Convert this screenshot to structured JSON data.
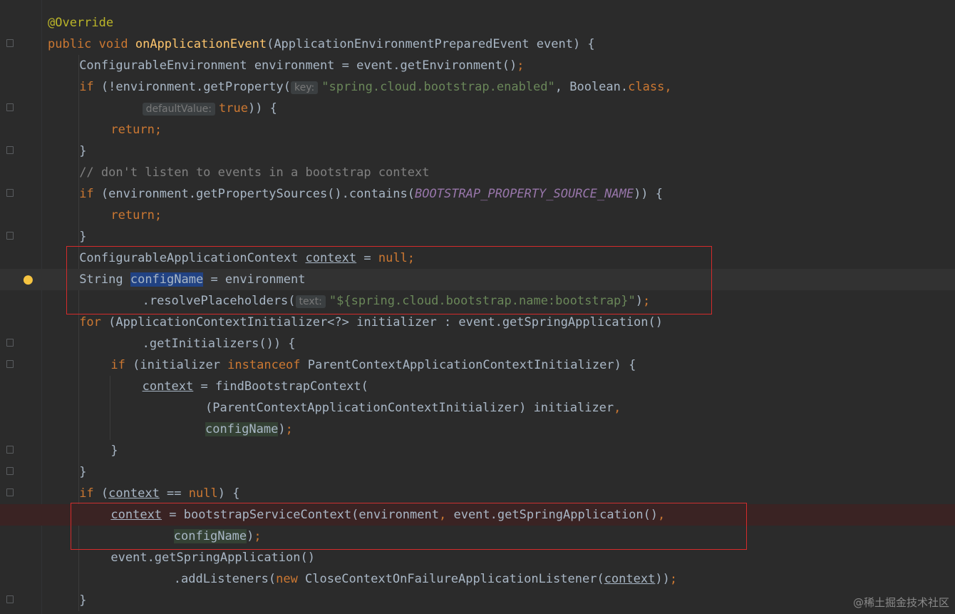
{
  "lines": [
    {
      "indent": 0,
      "tokens": [
        {
          "t": "@Override",
          "c": "an"
        }
      ]
    },
    {
      "indent": 0,
      "tokens": [
        {
          "t": "public ",
          "c": "kw"
        },
        {
          "t": "void ",
          "c": "kw"
        },
        {
          "t": "onApplicationEvent",
          "c": "fn"
        },
        {
          "t": "(ApplicationEnvironmentPreparedEvent event) {"
        }
      ]
    },
    {
      "indent": 4,
      "tokens": [
        {
          "t": "ConfigurableEnvironment environment = event.getEnvironment()"
        },
        {
          "t": ";",
          "c": "kw"
        }
      ]
    },
    {
      "indent": 4,
      "tokens": [
        {
          "t": "if ",
          "c": "kw"
        },
        {
          "t": "(!environment.getProperty("
        },
        {
          "t": "key:",
          "c": "hint"
        },
        {
          "t": "\"spring.cloud.bootstrap.enabled\"",
          "c": "st"
        },
        {
          "t": ", "
        },
        {
          "t": "Boolean."
        },
        {
          "t": "class",
          "c": "kw"
        },
        {
          "t": ",",
          "c": "kw"
        }
      ]
    },
    {
      "indent": 12,
      "tokens": [
        {
          "t": "defaultValue:",
          "c": "hint"
        },
        {
          "t": "true",
          "c": "kw"
        },
        {
          "t": ")) {"
        }
      ]
    },
    {
      "indent": 8,
      "tokens": [
        {
          "t": "return",
          "c": "kw"
        },
        {
          "t": ";",
          "c": "kw"
        }
      ]
    },
    {
      "indent": 4,
      "tokens": [
        {
          "t": "}"
        }
      ]
    },
    {
      "indent": 4,
      "tokens": [
        {
          "t": "// don't listen to events in a bootstrap context",
          "c": "cm"
        }
      ]
    },
    {
      "indent": 4,
      "tokens": [
        {
          "t": "if ",
          "c": "kw"
        },
        {
          "t": "(environment.getPropertySources().contains("
        },
        {
          "t": "BOOTSTRAP_PROPERTY_SOURCE_NAME",
          "c": "cn"
        },
        {
          "t": ")) {"
        }
      ]
    },
    {
      "indent": 8,
      "tokens": [
        {
          "t": "return",
          "c": "kw"
        },
        {
          "t": ";",
          "c": "kw"
        }
      ]
    },
    {
      "indent": 4,
      "tokens": [
        {
          "t": "}"
        }
      ]
    },
    {
      "indent": 4,
      "tokens": [
        {
          "t": "ConfigurableApplicationContext "
        },
        {
          "t": "context",
          "c": "ul"
        },
        {
          "t": " = "
        },
        {
          "t": "null",
          "c": "kw"
        },
        {
          "t": ";",
          "c": "kw"
        }
      ]
    },
    {
      "indent": 4,
      "tokens": [
        {
          "t": "String "
        },
        {
          "t": "configName",
          "c": "sel"
        },
        {
          "t": " = environment"
        }
      ]
    },
    {
      "indent": 12,
      "tokens": [
        {
          "t": ".resolvePlaceholders("
        },
        {
          "t": "text:",
          "c": "hint"
        },
        {
          "t": "\"${spring.cloud.bootstrap.name:bootstrap}\"",
          "c": "st"
        },
        {
          "t": ")"
        },
        {
          "t": ";",
          "c": "kw"
        }
      ]
    },
    {
      "indent": 4,
      "tokens": [
        {
          "t": "for ",
          "c": "kw"
        },
        {
          "t": "(ApplicationContextInitializer<?> initializer : event.getSpringApplication()"
        }
      ]
    },
    {
      "indent": 12,
      "tokens": [
        {
          "t": ".getInitializers()) {"
        }
      ]
    },
    {
      "indent": 8,
      "tokens": [
        {
          "t": "if ",
          "c": "kw"
        },
        {
          "t": "(initializer "
        },
        {
          "t": "instanceof ",
          "c": "kw"
        },
        {
          "t": "ParentContextApplicationContextInitializer) {"
        }
      ]
    },
    {
      "indent": 12,
      "tokens": [
        {
          "t": "context",
          "c": "ul"
        },
        {
          "t": " = findBootstrapContext("
        }
      ]
    },
    {
      "indent": 20,
      "tokens": [
        {
          "t": "(ParentContextApplicationContextInitializer) initializer"
        },
        {
          "t": ",",
          "c": "kw"
        }
      ]
    },
    {
      "indent": 20,
      "tokens": [
        {
          "t": "configName",
          "c": "ref"
        },
        {
          "t": ")"
        },
        {
          "t": ";",
          "c": "kw"
        }
      ]
    },
    {
      "indent": 8,
      "tokens": [
        {
          "t": "}"
        }
      ]
    },
    {
      "indent": 4,
      "tokens": [
        {
          "t": "}"
        }
      ]
    },
    {
      "indent": 4,
      "tokens": [
        {
          "t": "if ",
          "c": "kw"
        },
        {
          "t": "("
        },
        {
          "t": "context",
          "c": "ul"
        },
        {
          "t": " == "
        },
        {
          "t": "null",
          "c": "kw"
        },
        {
          "t": ") {"
        }
      ]
    },
    {
      "indent": 8,
      "tokens": [
        {
          "t": "context",
          "c": "ul"
        },
        {
          "t": " = bootstrapServiceContext(environment"
        },
        {
          "t": ", ",
          "c": "kw"
        },
        {
          "t": "event.getSpringApplication()"
        },
        {
          "t": ",",
          "c": "kw"
        }
      ]
    },
    {
      "indent": 16,
      "tokens": [
        {
          "t": "configName",
          "c": "ref"
        },
        {
          "t": ")"
        },
        {
          "t": ";",
          "c": "kw"
        }
      ]
    },
    {
      "indent": 8,
      "tokens": [
        {
          "t": "event.getSpringApplication()"
        }
      ]
    },
    {
      "indent": 16,
      "tokens": [
        {
          "t": ".addListeners("
        },
        {
          "t": "new ",
          "c": "kw"
        },
        {
          "t": "CloseContextOnFailureApplicationListener("
        },
        {
          "t": "context",
          "c": "ul"
        },
        {
          "t": "))"
        },
        {
          "t": ";",
          "c": "kw"
        }
      ]
    },
    {
      "indent": 4,
      "tokens": [
        {
          "t": "}"
        }
      ]
    }
  ],
  "caret_line": 12,
  "breakpoint_line": 23,
  "intention_icon": "lightbulb-icon",
  "fold_markers": [
    1,
    4,
    6,
    8,
    10,
    15,
    16,
    20,
    21,
    22,
    27
  ],
  "highlight_boxes": [
    {
      "from_line": 11,
      "to_line": 13,
      "label": "context-initialization"
    },
    {
      "from_line": 23,
      "to_line": 24,
      "label": "bootstrap-service-context-call"
    }
  ],
  "watermark": "@稀土掘金技术社区",
  "colors": {
    "background": "#2b2b2b",
    "keyword": "#cc7832",
    "method": "#ffc66d",
    "string": "#6a8759",
    "comment": "#808080",
    "constant": "#9876aa",
    "annotation": "#bbb529",
    "highlight": "#d52b2b"
  }
}
